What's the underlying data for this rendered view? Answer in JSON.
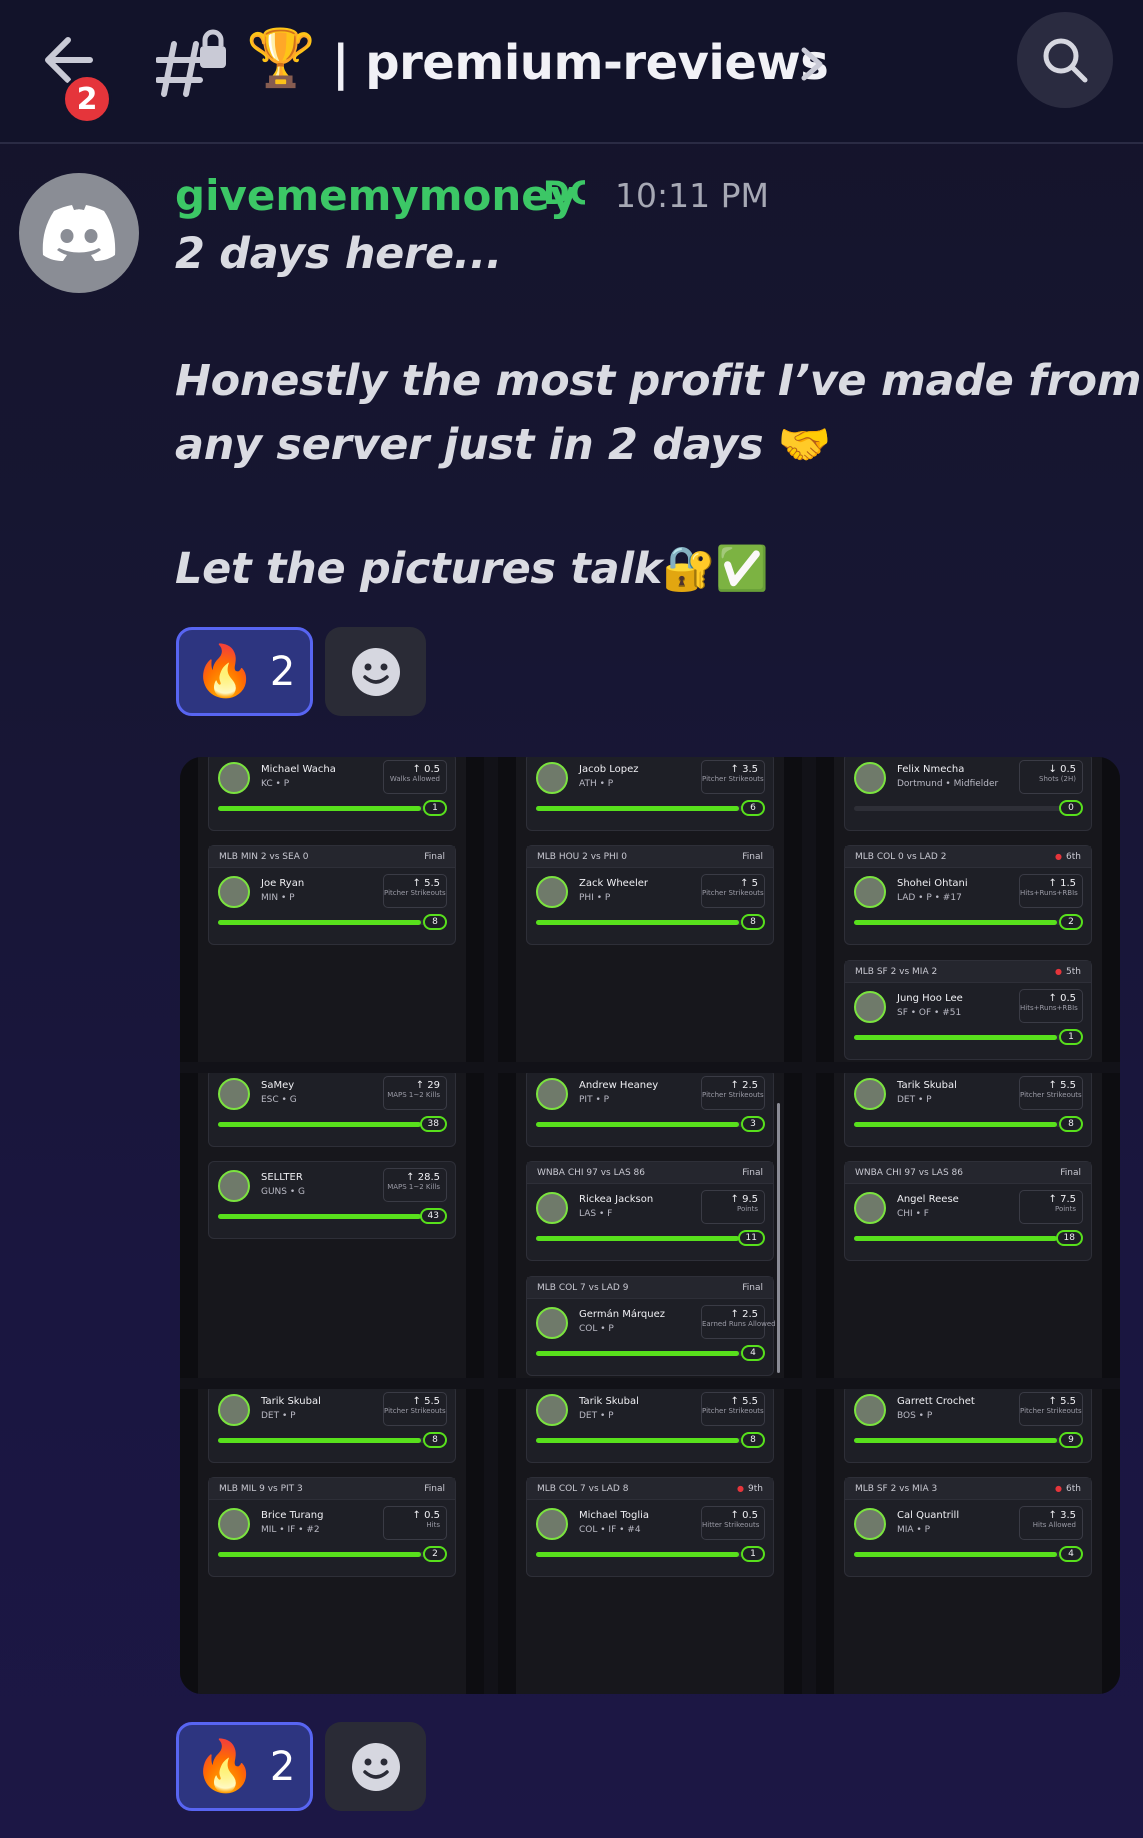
{
  "header": {
    "notification_count": "2",
    "trophy_emoji": "🏆",
    "channel_name": "| premium-reviews"
  },
  "message": {
    "username": "givememymoney",
    "tag": "DC",
    "timestamp": "10:11 PM",
    "lines": [
      "2 days here...",
      "Honestly the most profit I’ve made from",
      "any server just in 2 days",
      "Let the pictures talk"
    ],
    "emojis": {
      "handshake": "🤝",
      "lock_key": "🔐",
      "check": "✅"
    }
  },
  "reactions": {
    "fire_emoji": "🔥",
    "fire_count": "2"
  },
  "tiles": [
    {
      "cards": [
        {
          "head": null,
          "name": "Michael Wacha",
          "sub": "KC • P",
          "line": "↑ 0.5",
          "cat": "Walks Allowed",
          "val": "1",
          "fill": 0.96
        }
      ],
      "cards2": [
        {
          "head_left": "MLB   MIN 2 vs SEA 0",
          "head_right": "Final",
          "name": "Joe Ryan",
          "sub": "MIN • P",
          "line": "↑ 5.5",
          "cat": "Pitcher Strikeouts",
          "val": "8",
          "fill": 0.96
        }
      ]
    },
    {
      "cards": [
        {
          "head": null,
          "name": "Jacob Lopez",
          "sub": "ATH • P",
          "line": "↑ 3.5",
          "cat": "Pitcher Strikeouts",
          "val": "6",
          "fill": 0.96
        }
      ],
      "cards2": [
        {
          "head_left": "MLB   HOU 2 vs PHI 0",
          "head_right": "Final",
          "name": "Zack Wheeler",
          "sub": "PHI • P",
          "line": "↑ 5",
          "cat": "Pitcher Strikeouts",
          "val": "8",
          "fill": 0.96
        }
      ]
    },
    {
      "cards": [
        {
          "head": null,
          "name": "Felix Nmecha",
          "sub": "Dortmund • Midfielder",
          "line": "↓ 0.5",
          "cat": "Shots (2H)",
          "val": "0",
          "fill": 0.0
        }
      ],
      "cards2": [
        {
          "head_left": "MLB   COL 0 vs LAD 2",
          "head_right": "6th",
          "live": true,
          "name": "Shohei Ohtani",
          "sub": "LAD • P • #17",
          "line": "↑ 1.5",
          "cat": "Hits+Runs+RBIs",
          "val": "2",
          "fill": 0.96
        },
        {
          "head_left": "MLB   SF 2 vs MIA 2",
          "head_right": "5th",
          "live": true,
          "name": "Jung Hoo Lee",
          "sub": "SF • OF • #51",
          "line": "↑ 0.5",
          "cat": "Hits+Runs+RBIs",
          "val": "1",
          "fill": 0.96
        }
      ]
    },
    {
      "cards": [
        {
          "head": null,
          "name": "SaMey",
          "sub": "ESC • G",
          "line": "↑ 29",
          "cat": "MAPS 1~2 Kills",
          "val": "38",
          "fill": 0.96
        },
        {
          "head": null,
          "name": "SELLTER",
          "sub": "GUNS • G",
          "line": "↑ 28.5",
          "cat": "MAPS 1~2 Kills",
          "val": "43",
          "fill": 0.96
        }
      ]
    },
    {
      "cards": [
        {
          "head": null,
          "name": "Andrew Heaney",
          "sub": "PIT • P",
          "line": "↑ 2.5",
          "cat": "Pitcher Strikeouts",
          "val": "3",
          "fill": 0.96
        }
      ],
      "cards2": [
        {
          "head_left": "WNBA   CHI 97 vs LAS 86",
          "head_right": "Final",
          "name": "Rickea Jackson",
          "sub": "LAS • F",
          "line": "↑ 9.5",
          "cat": "Points",
          "val": "11",
          "fill": 0.96
        },
        {
          "head_left": "MLB   COL 7 vs LAD 9",
          "head_right": "Final",
          "name": "Germán Márquez",
          "sub": "COL • P",
          "line": "↑ 2.5",
          "cat": "Earned Runs Allowed",
          "val": "4",
          "fill": 0.96
        }
      ]
    },
    {
      "cards": [
        {
          "head": null,
          "name": "Tarik Skubal",
          "sub": "DET • P",
          "line": "↑ 5.5",
          "cat": "Pitcher Strikeouts",
          "val": "8",
          "fill": 0.96
        }
      ],
      "cards2": [
        {
          "head_left": "WNBA   CHI 97 vs LAS 86",
          "head_right": "Final",
          "name": "Angel Reese",
          "sub": "CHI • F",
          "line": "↑ 7.5",
          "cat": "Points",
          "val": "18",
          "fill": 0.96
        }
      ]
    },
    {
      "cards": [
        {
          "head": null,
          "name": "Tarik Skubal",
          "sub": "DET • P",
          "line": "↑ 5.5",
          "cat": "Pitcher Strikeouts",
          "val": "8",
          "fill": 0.96
        }
      ],
      "cards2": [
        {
          "head_left": "MLB   MIL 9 vs PIT 3",
          "head_right": "Final",
          "name": "Brice Turang",
          "sub": "MIL • IF • #2",
          "line": "↑ 0.5",
          "cat": "Hits",
          "val": "2",
          "fill": 0.96
        }
      ]
    },
    {
      "cards": [
        {
          "head": null,
          "name": "Tarik Skubal",
          "sub": "DET • P",
          "line": "↑ 5.5",
          "cat": "Pitcher Strikeouts",
          "val": "8",
          "fill": 0.96
        }
      ],
      "cards2": [
        {
          "head_left": "MLB   COL 7 vs LAD 8",
          "head_right": "9th",
          "live": true,
          "name": "Michael Toglia",
          "sub": "COL • IF • #4",
          "line": "↑ 0.5",
          "cat": "Hitter Strikeouts",
          "val": "1",
          "fill": 0.96
        }
      ]
    },
    {
      "cards": [
        {
          "head": null,
          "name": "Garrett Crochet",
          "sub": "BOS • P",
          "line": "↑ 5.5",
          "cat": "Pitcher Strikeouts",
          "val": "9",
          "fill": 0.96
        }
      ],
      "cards2": [
        {
          "head_left": "MLB   SF 2 vs MIA 3",
          "head_right": "6th",
          "live": true,
          "name": "Cal Quantrill",
          "sub": "MIA • P",
          "line": "↑ 3.5",
          "cat": "Hits Allowed",
          "val": "4",
          "fill": 0.96
        }
      ]
    }
  ]
}
